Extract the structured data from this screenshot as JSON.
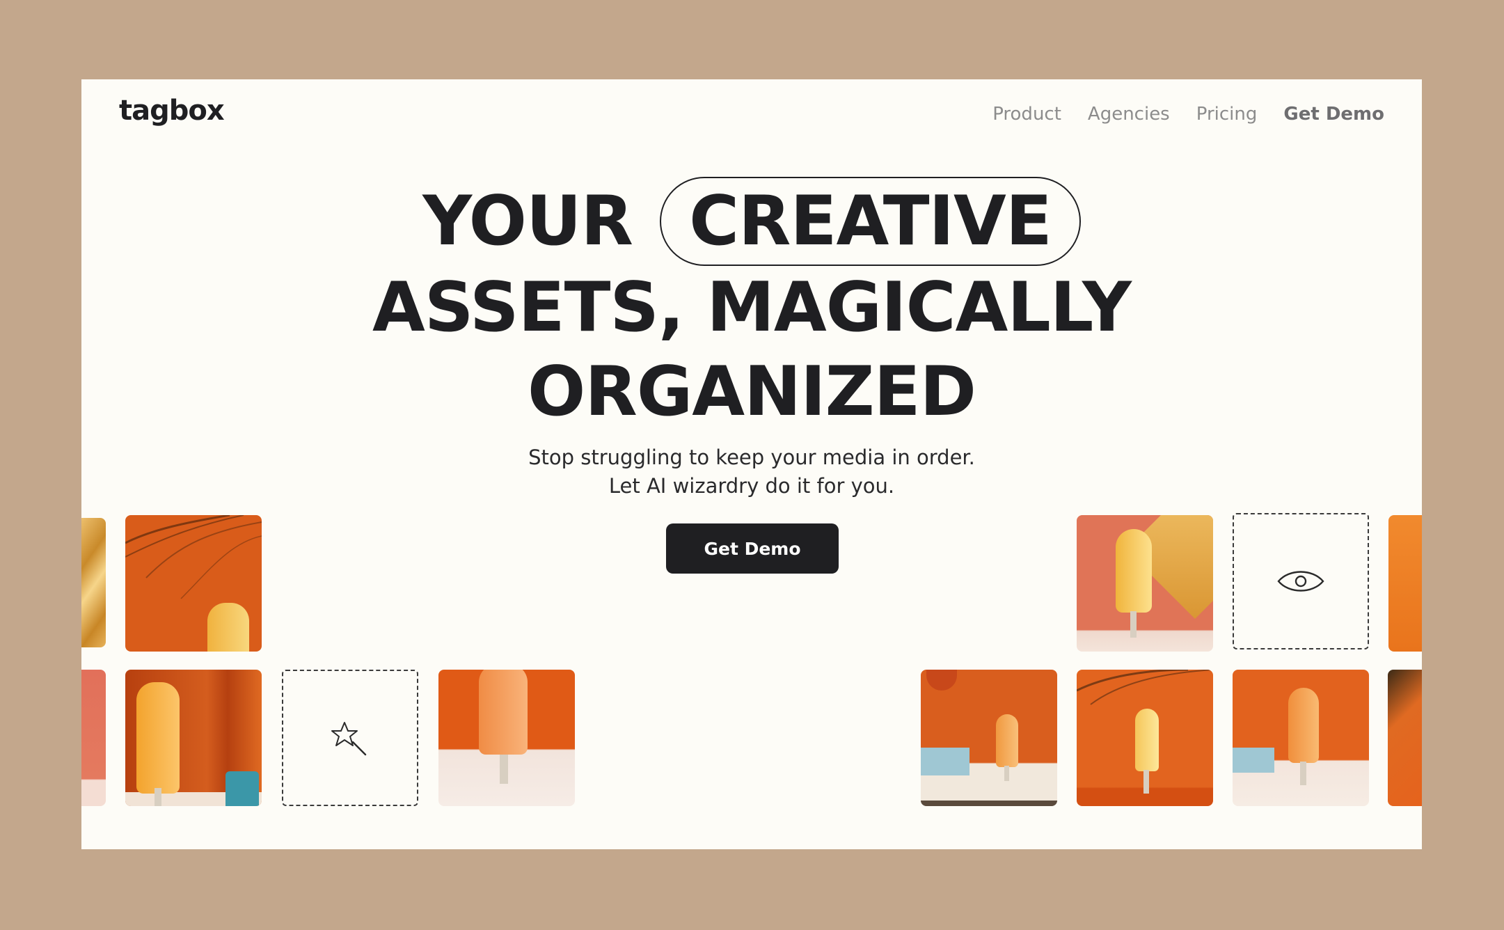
{
  "brand": {
    "logo_text": "tagbox"
  },
  "nav": {
    "items": [
      "Product",
      "Agencies",
      "Pricing"
    ],
    "cta_label": "Get Demo"
  },
  "hero": {
    "line1": "YOUR",
    "highlight": "CREATIVE",
    "line2": "ASSETS, MAGICALLY",
    "line3": "ORGANIZED",
    "subtitle_line1": "Stop struggling to keep your media in order.",
    "subtitle_line2": "Let AI wizardry do it for you.",
    "cta_label": "Get Demo"
  },
  "icons": {
    "placeholder_left": "magic-wand-icon",
    "placeholder_right": "eye-icon"
  },
  "colors": {
    "background": "#c3a78c",
    "page": "#fdfcf7",
    "ink": "#1f1f22",
    "nav_text": "#8c8c8c",
    "orange": "#e0601d",
    "popsicle": "#f4a53b"
  }
}
